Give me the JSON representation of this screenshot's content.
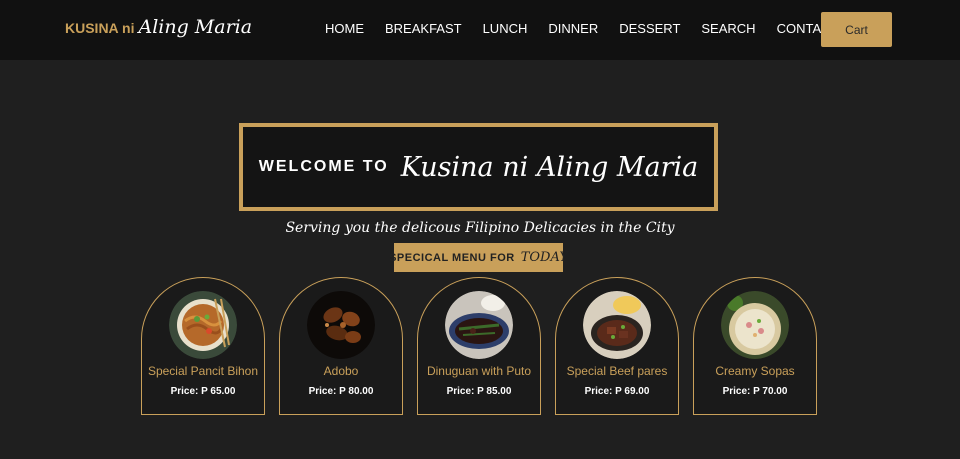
{
  "brand": {
    "main": "KUSINA ni",
    "script": "Aling Maria"
  },
  "nav": {
    "items": [
      "HOME",
      "BREAKFAST",
      "LUNCH",
      "DINNER",
      "DESSERT",
      "SEARCH",
      "CONTACT"
    ],
    "cart_label": "Cart"
  },
  "hero": {
    "welcome_small": "WELCOME TO",
    "welcome_script": "Kusina ni Aling Maria",
    "tagline": "Serving you the delicous Filipino Delicacies in the City"
  },
  "special": {
    "part_a": "SPECICAL  MENU  FOR",
    "part_b": "TODAY"
  },
  "menu_items": [
    {
      "name": "Special Pancit Bihon",
      "price": "Price: P 65.00"
    },
    {
      "name": "Adobo",
      "price": "Price: P 80.00"
    },
    {
      "name": "Dinuguan with Puto",
      "price": "Price: P 85.00"
    },
    {
      "name": "Special Beef pares",
      "price": "Price: P 69.00"
    },
    {
      "name": "Creamy Sopas",
      "price": "Price: P 70.00"
    }
  ],
  "colors": {
    "accent": "#c9a05a",
    "nav_bg": "#111111",
    "page_bg": "#1f1f1f"
  }
}
